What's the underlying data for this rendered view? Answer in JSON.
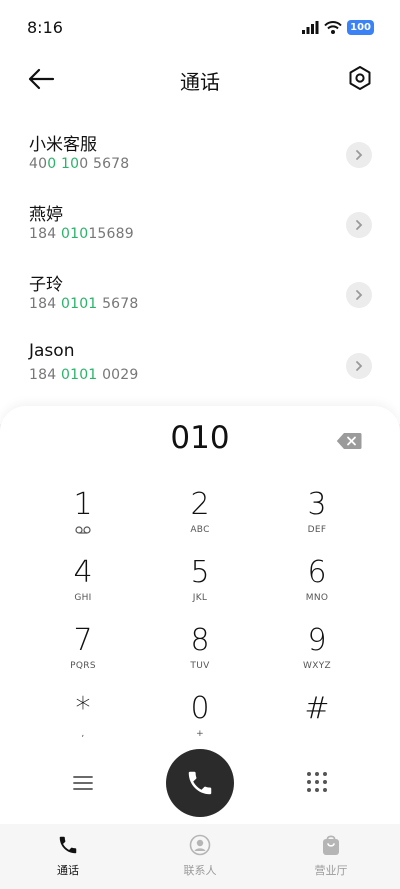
{
  "status_bar": {
    "time": "8:16",
    "battery": "100"
  },
  "header": {
    "title": "通话"
  },
  "contacts": [
    {
      "name": "小米客服",
      "number_parts": [
        "40",
        "0",
        " ",
        "10",
        "0 5678"
      ]
    },
    {
      "name": "燕婷",
      "number_parts": [
        "184 ",
        "010",
        "15689"
      ]
    },
    {
      "name": "子玲",
      "number_parts": [
        "184 ",
        "0101",
        " 5678"
      ]
    },
    {
      "name": "Jason",
      "number_parts": [
        "184 ",
        "0101",
        " 0029"
      ]
    }
  ],
  "dialer": {
    "input": "010",
    "keys": [
      {
        "digit": "1",
        "letters": ""
      },
      {
        "digit": "2",
        "letters": "ABC"
      },
      {
        "digit": "3",
        "letters": "DEF"
      },
      {
        "digit": "4",
        "letters": "GHI"
      },
      {
        "digit": "5",
        "letters": "JKL"
      },
      {
        "digit": "6",
        "letters": "MNO"
      },
      {
        "digit": "7",
        "letters": "PQRS"
      },
      {
        "digit": "8",
        "letters": "TUV"
      },
      {
        "digit": "9",
        "letters": "WXYZ"
      },
      {
        "digit": "*",
        "letters": ","
      },
      {
        "digit": "0",
        "letters": "+"
      },
      {
        "digit": "#",
        "letters": ""
      }
    ]
  },
  "tabs": [
    {
      "label": "通话",
      "icon": "phone-icon",
      "active": true
    },
    {
      "label": "联系人",
      "icon": "contact-icon",
      "active": false
    },
    {
      "label": "营业厅",
      "icon": "bag-icon",
      "active": false
    }
  ],
  "colors": {
    "highlight": "#2bb36b",
    "battery": "#3b82f6",
    "call_button": "#2b2b2b"
  }
}
